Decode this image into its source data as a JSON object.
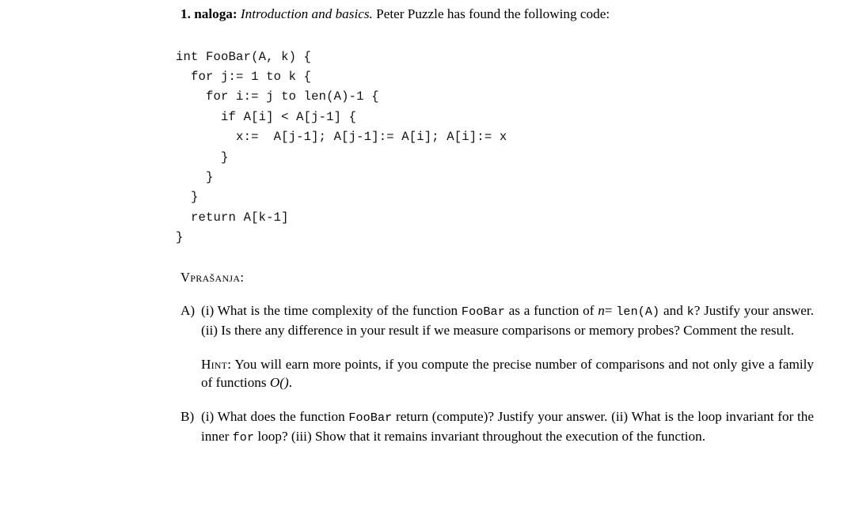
{
  "document": {
    "problem": {
      "number_label": "1. naloga:",
      "subject": "Introduction and basics.",
      "lead_in": "Peter Puzzle has found the following code:"
    },
    "code_block": {
      "language": "pseudocode",
      "lines": [
        "int FooBar(A, k) {",
        "  for j:= 1 to k {",
        "    for i:= j to len(A)-1 {",
        "      if A[i] < A[j-1] {",
        "        x:=  A[j-1]; A[j-1]:= A[i]; A[i]:= x",
        "      }",
        "    }",
        "  }",
        "  return A[k-1]",
        "}"
      ],
      "text": "int FooBar(A, k) {\n  for j:= 1 to k {\n    for i:= j to len(A)-1 {\n      if A[i] < A[j-1] {\n        x:=  A[j-1]; A[j-1]:= A[i]; A[i]:= x\n      }\n    }\n  }\n  return A[k-1]\n}"
    },
    "questions_heading": "Vprašanja:",
    "questions": [
      {
        "label": "A)",
        "paragraphs": [
          {
            "id": "a-main",
            "segments": [
              {
                "type": "text",
                "value": "(i) What is the time complexity of the function "
              },
              {
                "type": "code",
                "value": "FooBar"
              },
              {
                "type": "text",
                "value": " as a function of "
              },
              {
                "type": "math",
                "value": "n"
              },
              {
                "type": "text",
                "value": "= "
              },
              {
                "type": "code",
                "value": "len(A)"
              },
              {
                "type": "text",
                "value": " and "
              },
              {
                "type": "code",
                "value": "k"
              },
              {
                "type": "text",
                "value": "? Justify your answer. (ii) Is there any difference in your result if we measure comparisons or memory probes? Comment the result."
              }
            ]
          },
          {
            "id": "a-hint",
            "hint_label": "Hint:",
            "segments": [
              {
                "type": "text",
                "value": "You will earn more points, if you compute the precise number of comparisons and not only give a family of functions "
              },
              {
                "type": "math",
                "value": "O()"
              },
              {
                "type": "text",
                "value": "."
              }
            ]
          }
        ]
      },
      {
        "label": "B)",
        "paragraphs": [
          {
            "id": "b-main",
            "segments": [
              {
                "type": "text",
                "value": "(i) What does the function "
              },
              {
                "type": "code",
                "value": "FooBar"
              },
              {
                "type": "text",
                "value": " return (compute)? Justify your answer. (ii) What is the loop invariant for the inner "
              },
              {
                "type": "code",
                "value": "for"
              },
              {
                "type": "text",
                "value": " loop? (iii) Show that it remains invariant throughout the execution of the function."
              }
            ]
          }
        ]
      }
    ]
  },
  "text_fragments": {
    "a_line1_a": "(i) What is the time complexity of the function ",
    "a_line1_b": " as a function of ",
    "a_n": "n",
    "a_eq": "=",
    "a_len": "len(A)",
    "a_and": " and ",
    "a_k": "k",
    "a_rest": "? Justify your answer. (ii) Is there any difference in your result if we measure comparisons or memory probes? Comment the result.",
    "a_foobar": "FooBar",
    "hint_label": "Hint:",
    "hint_body_1": "You will earn more points, if you compute the precise number of comparisons and not only give a family of functions ",
    "hint_math": "O()",
    "hint_period": ".",
    "b_line1_a": "(i) What does the function ",
    "b_foobar": "FooBar",
    "b_line1_b": " return (compute)? Justify your answer. (ii) What is the loop invariant for the inner ",
    "b_for": "for",
    "b_line1_c": " loop? (iii) Show that it remains invariant throughout the execution of the function."
  }
}
